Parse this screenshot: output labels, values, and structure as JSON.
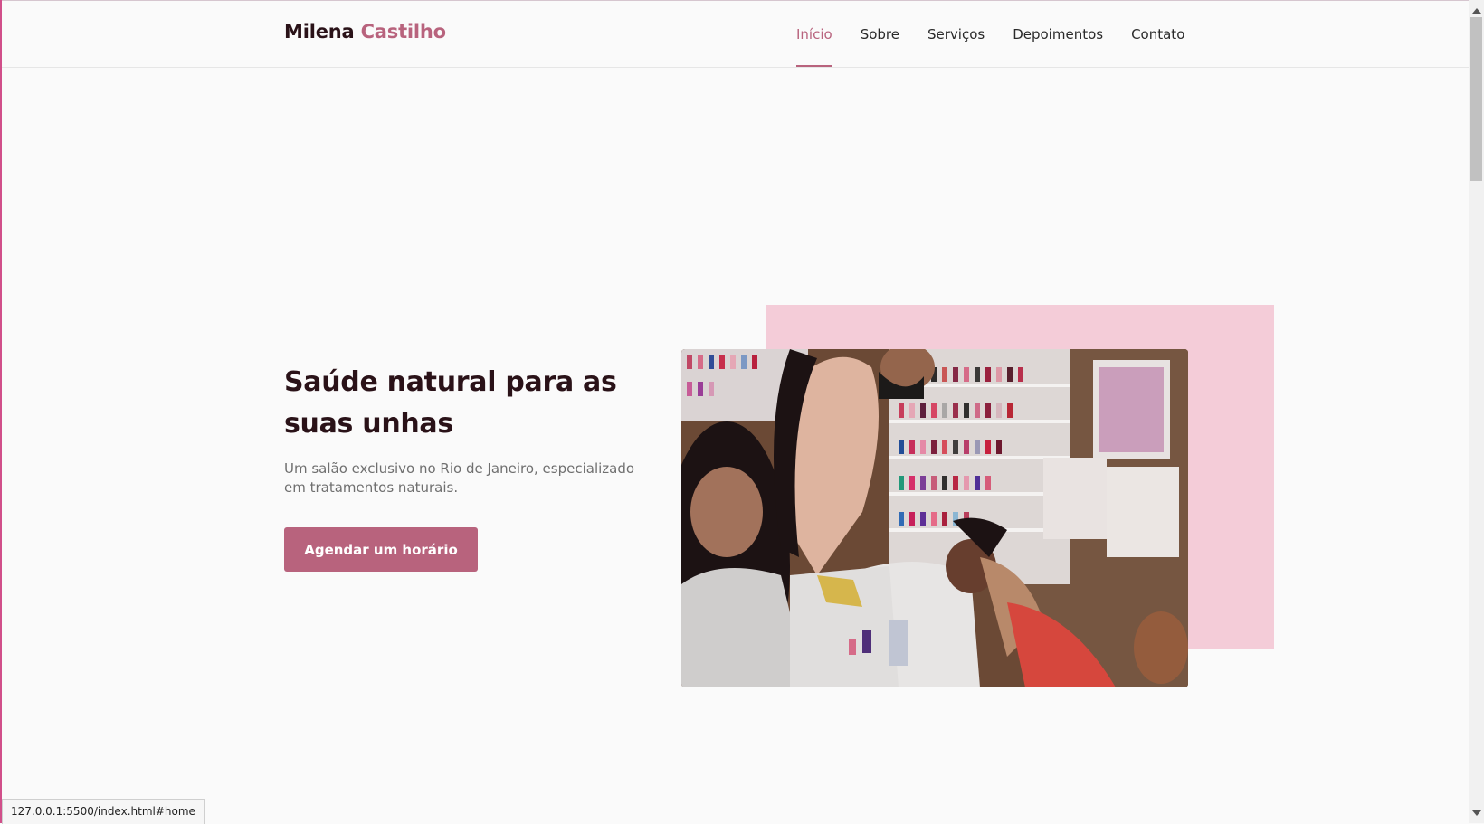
{
  "header": {
    "logo_first": "Milena",
    "logo_second": "Castilho",
    "nav": [
      {
        "label": "Início",
        "active": true
      },
      {
        "label": "Sobre"
      },
      {
        "label": "Serviços"
      },
      {
        "label": "Depoimentos"
      },
      {
        "label": "Contato"
      }
    ]
  },
  "hero": {
    "title": "Saúde natural para as suas unhas",
    "subtitle": "Um salão exclusivo no Rio de Janeiro, especializado em tratamentos naturais.",
    "cta_label": "Agendar um horário"
  },
  "status_bar": {
    "url": "127.0.0.1:5500/index.html#home"
  },
  "colors": {
    "accent": "#b8637d",
    "accent_light": "#f4ccd8",
    "dark_text": "#2a1218",
    "background": "#fafafa"
  }
}
